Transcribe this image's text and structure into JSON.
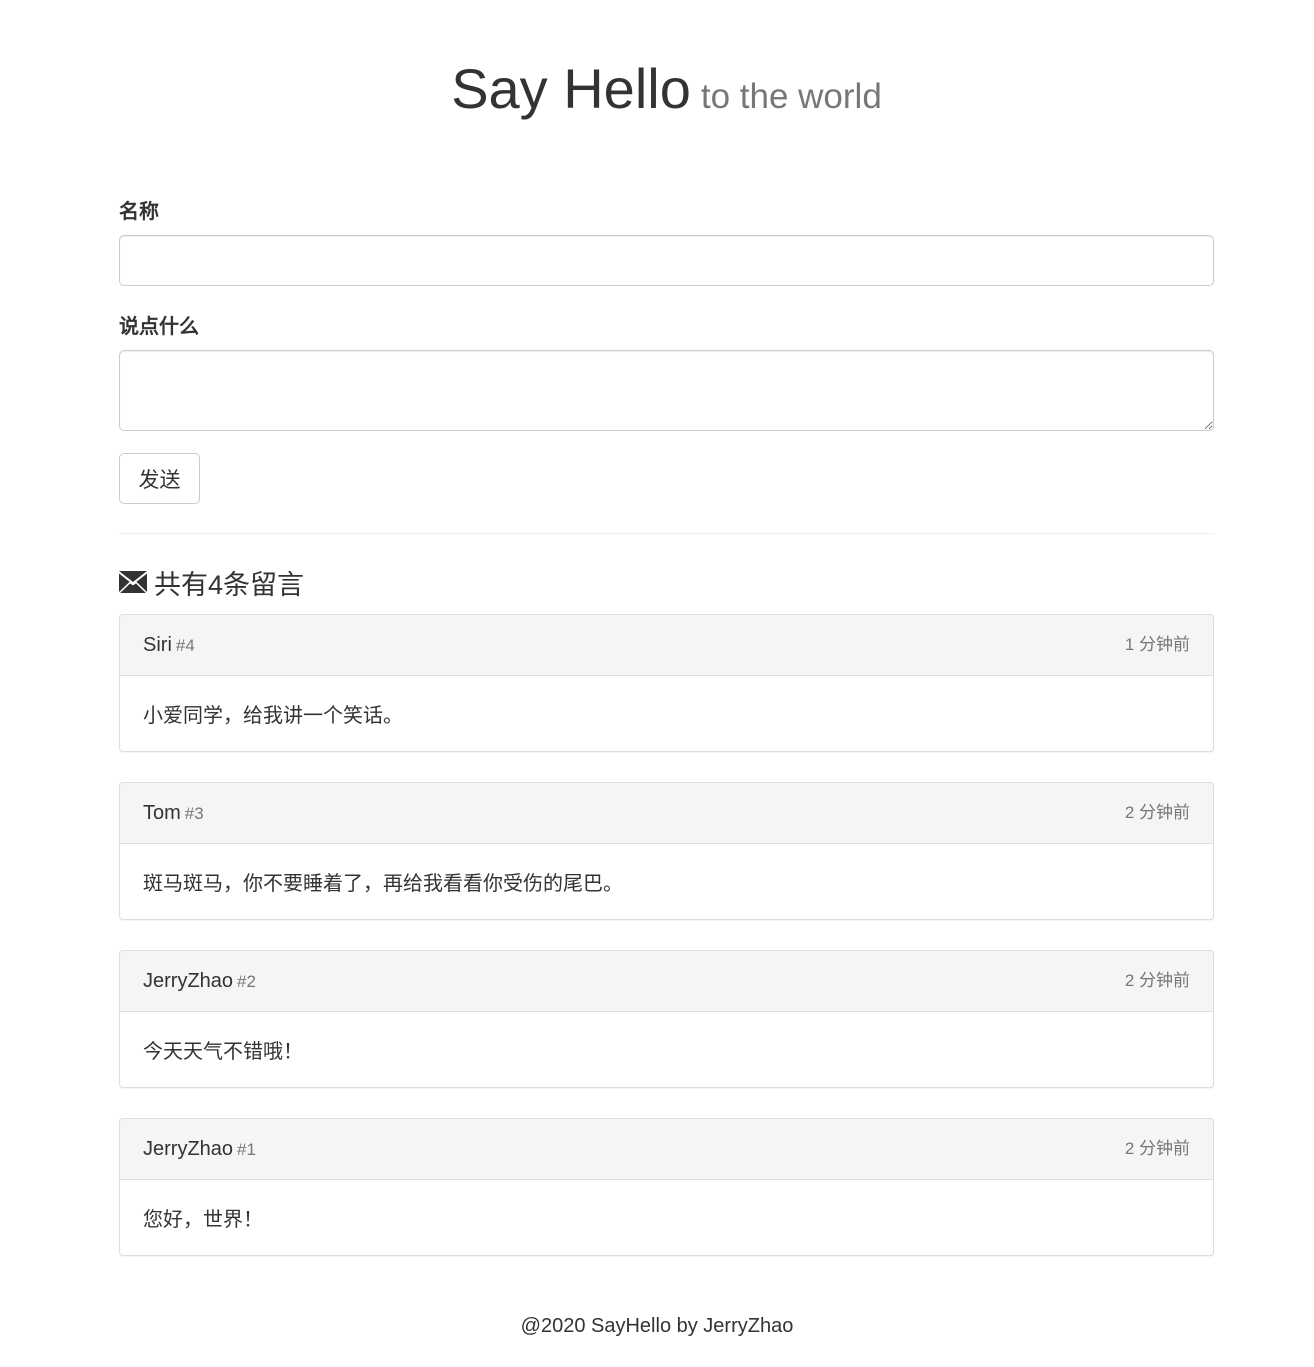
{
  "header": {
    "title": "Say Hello",
    "subtitle": "to the world"
  },
  "form": {
    "name_label": "名称",
    "name_value": "",
    "body_label": "说点什么",
    "body_value": "",
    "submit_label": "发送"
  },
  "messages": {
    "heading": "共有4条留言",
    "icon": "envelope-icon",
    "items": [
      {
        "author": "Siri",
        "number": "#4",
        "time": "1 分钟前",
        "body": "小爱同学，给我讲一个笑话。"
      },
      {
        "author": "Tom",
        "number": "#3",
        "time": "2 分钟前",
        "body": "斑马斑马，你不要睡着了，再给我看看你受伤的尾巴。"
      },
      {
        "author": "JerryZhao",
        "number": "#2",
        "time": "2 分钟前",
        "body": "今天天气不错哦！"
      },
      {
        "author": "JerryZhao",
        "number": "#1",
        "time": "2 分钟前",
        "body": "您好，世界！"
      }
    ]
  },
  "footer": {
    "text": "@2020 SayHello by JerryZhao"
  },
  "colors": {
    "text": "#333333",
    "muted": "#777777",
    "panel_heading_bg": "#f5f5f5",
    "border": "#dddddd"
  }
}
